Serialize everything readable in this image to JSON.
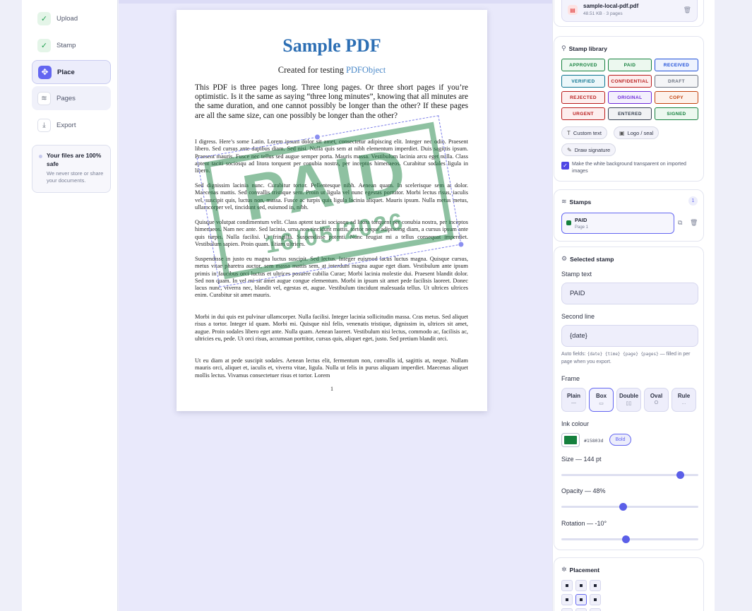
{
  "sidebar": {
    "steps": [
      {
        "label": "Upload",
        "icon": "check-icon"
      },
      {
        "label": "Stamp",
        "icon": "check-icon"
      },
      {
        "label": "Place",
        "icon": "move-icon"
      },
      {
        "label": "Pages",
        "icon": "layers-icon"
      },
      {
        "label": "Export",
        "icon": "download-icon"
      }
    ],
    "safe": {
      "title": "Your files are 100% safe",
      "text": "We never store or share your documents."
    }
  },
  "document": {
    "title": "Sample PDF",
    "subtitle_prefix": "Created for testing ",
    "subtitle_link": "PDFObject",
    "lead": "This PDF is three pages long. Three long pages. Or three short pages if you’re optimistic. Is it the same as saying “three long minutes”, knowing that all minutes are the same duration, and one cannot possibly be longer than the other? If these pages are all the same size, can one possibly be longer than the other?",
    "paragraphs": [
      "I digress. Here’s some Latin. Lorem ipsum dolor sit amet, consectetur adipiscing elit. Integer nec odio. Praesent libero. Sed cursus ante dapibus diam. Sed nisi. Nulla quis sem at nibh elementum imperdiet. Duis sagittis ipsum. Praesent mauris. Fusce nec tellus sed augue semper porta. Mauris massa. Vestibulum lacinia arcu eget nulla. Class aptent taciti sociosqu ad litora torquent per conubia nostra, per inceptos himenaeos. Curabitur sodales ligula in libero.",
      "Sed dignissim lacinia nunc. Curabitur tortor. Pellentesque nibh. Aenean quam. In scelerisque sem at dolor. Maecenas mattis. Sed convallis tristique sem. Proin ut ligula vel nunc egestas porttitor. Morbi lectus risus, iaculis vel, suscipit quis, luctus non, massa. Fusce ac turpis quis ligula lacinia aliquet. Mauris ipsum. Nulla metus metus, ullamcorper vel, tincidunt sed, euismod in, nibh.",
      "Quisque volutpat condimentum velit. Class aptent taciti sociosqu ad litora torquent per conubia nostra, per inceptos himenaeos. Nam nec ante. Sed lacinia, urna non tincidunt mattis, tortor neque adipiscing diam, a cursus ipsum ante quis turpis. Nulla facilisi. Ut fringilla. Suspendisse potenti. Nunc feugiat mi a tellus consequat imperdiet. Vestibulum sapien. Proin quam. Etiam ultrices.",
      "Suspendisse in justo eu magna luctus suscipit. Sed lectus. Integer euismod lacus luctus magna. Quisque cursus, metus vitae pharetra auctor, sem massa mattis sem, at interdum magna augue eget diam. Vestibulum ante ipsum primis in faucibus orci luctus et ultrices posuere cubilia Curae; Morbi lacinia molestie dui. Praesent blandit dolor. Sed non quam. In vel mi sit amet augue congue elementum. Morbi in ipsum sit amet pede facilisis laoreet. Donec lacus nunc, viverra nec, blandit vel, egestas et, augue. Vestibulum tincidunt malesuada tellus. Ut ultrices ultrices enim. Curabitur sit amet mauris.",
      "Morbi in dui quis est pulvinar ullamcorper. Nulla facilisi. Integer lacinia sollicitudin massa. Cras metus. Sed aliquet risus a tortor. Integer id quam. Morbi mi. Quisque nisl felis, venenatis tristique, dignissim in, ultrices sit amet, augue. Proin sodales libero eget ante. Nulla quam. Aenean laoreet. Vestibulum nisi lectus, commodo ac, facilisis ac, ultricies eu, pede. Ut orci risus, accumsan porttitor, cursus quis, aliquet eget, justo. Sed pretium blandit orci.",
      "Ut eu diam at pede suscipit sodales. Aenean lectus elit, fermentum non, convallis id, sagittis at, neque. Nullam mauris orci, aliquet et, iaculis et, viverra vitae, ligula. Nulla ut felis in purus aliquam imperdiet. Maecenas aliquet mollis lectus. Vivamus consectetuer risus et tortor. Lorem"
    ],
    "page_number": "1",
    "stamp": {
      "text": "PAID",
      "second_line": "16/05/2026",
      "color": "#15803d",
      "rotation_deg": -10,
      "opacity": 0.48
    }
  },
  "file": {
    "name": "sample-local-pdf.pdf",
    "meta": "48.51 KB · 3 pages"
  },
  "library": {
    "title": "Stamp library",
    "chips": [
      {
        "label": "APPROVED",
        "color": "#15803d",
        "bg": "#ecf8ef"
      },
      {
        "label": "PAID",
        "color": "#15803d",
        "bg": "#ecf8ef"
      },
      {
        "label": "RECEIVED",
        "color": "#1d4ed8",
        "bg": "#eef3fe"
      },
      {
        "label": "VERIFIED",
        "color": "#0e7490",
        "bg": "#ecf7fa"
      },
      {
        "label": "CONFIDENTIAL",
        "color": "#b91c1c",
        "bg": "#fdeeee"
      },
      {
        "label": "DRAFT",
        "color": "#6b7280",
        "bg": "#f4f5f7"
      },
      {
        "label": "REJECTED",
        "color": "#b91c1c",
        "bg": "#fdeeee"
      },
      {
        "label": "ORIGINAL",
        "color": "#6d28d9",
        "bg": "#f3effd"
      },
      {
        "label": "COPY",
        "color": "#c2410c",
        "bg": "#fdf1ea"
      },
      {
        "label": "URGENT",
        "color": "#b91c1c",
        "bg": "#fdeeee"
      },
      {
        "label": "ENTERED",
        "color": "#374151",
        "bg": "#f1f2f4"
      },
      {
        "label": "SIGNED",
        "color": "#15803d",
        "bg": "#ecf8ef"
      }
    ],
    "custom_text": "Custom text",
    "logo_seal": "Logo / seal",
    "draw_signature": "Draw signature",
    "transparent_label": "Make the white background transparent on imported images"
  },
  "stamps": {
    "title": "Stamps",
    "count": "1",
    "items": [
      {
        "name": "PAID",
        "page": "Page 1"
      }
    ]
  },
  "selected": {
    "title": "Selected stamp",
    "text_label": "Stamp text",
    "text_value": "PAID",
    "second_label": "Second line",
    "second_value": "{date}",
    "hint_prefix": "Auto fields: ",
    "hint_codes": "{date} {time} {page} {pages}",
    "hint_suffix": " — filled in per page when you export.",
    "frame_label": "Frame",
    "frames": [
      {
        "name": "Plain",
        "glyph": "—"
      },
      {
        "name": "Box",
        "glyph": "▭"
      },
      {
        "name": "Double",
        "glyph": "▯▯"
      },
      {
        "name": "Oval",
        "glyph": "O"
      },
      {
        "name": "Rule",
        "glyph": "..."
      }
    ],
    "ink_label": "Ink colour",
    "ink_hex": "#15803d",
    "bold_label": "Bold",
    "size_label": "Size — 144 pt",
    "size_fraction": 0.87,
    "opacity_label": "Opacity — 48%",
    "opacity_fraction": 0.45,
    "rotation_label": "Rotation — -10°",
    "rotation_fraction": 0.47
  },
  "placement": {
    "title": "Placement"
  }
}
